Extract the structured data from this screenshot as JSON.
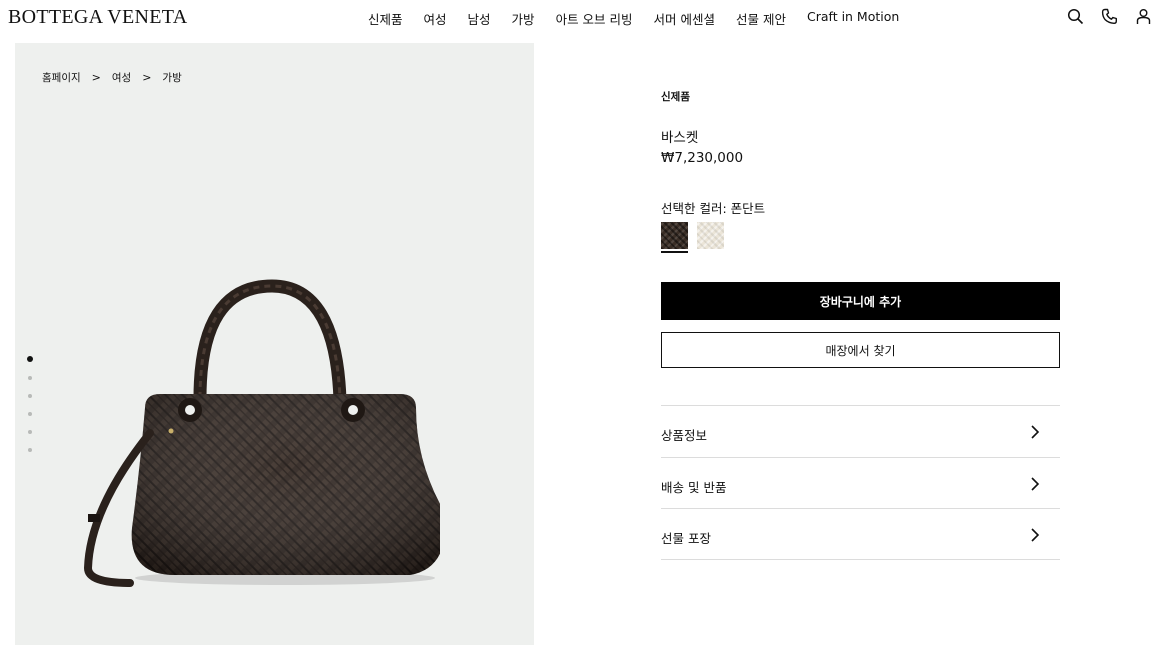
{
  "brand": {
    "logo": "BOTTEGA VENETA"
  },
  "nav": {
    "items": [
      "신제품",
      "여성",
      "남성",
      "가방",
      "아트 오브 리빙",
      "서머 에센셜",
      "선물 제안",
      "Craft in Motion"
    ]
  },
  "header_icons": [
    "search-icon",
    "phone-icon",
    "user-icon"
  ],
  "breadcrumb": {
    "items": [
      "홈페이지",
      "여성",
      "가방"
    ],
    "separator": ">"
  },
  "gallery": {
    "image_count": 6,
    "active_index": 0
  },
  "product": {
    "badge": "신제품",
    "name": "바스켓",
    "price": "₩7,230,000",
    "color_label": "선택한 컬러: 폰단트",
    "swatches": [
      {
        "name": "dark-brown",
        "color": "#3a2e26",
        "selected": true
      },
      {
        "name": "cream",
        "color": "#ebe5d8",
        "selected": false
      }
    ]
  },
  "actions": {
    "add_to_cart": "장바구니에 추가",
    "find_in_store": "매장에서 찾기"
  },
  "accordion": {
    "items": [
      "상품정보",
      "배송 및 반품",
      "선물 포장"
    ]
  },
  "colors": {
    "primary": "#000000",
    "panel_bg": "#eef0ee",
    "divider": "#dcdcdc"
  }
}
